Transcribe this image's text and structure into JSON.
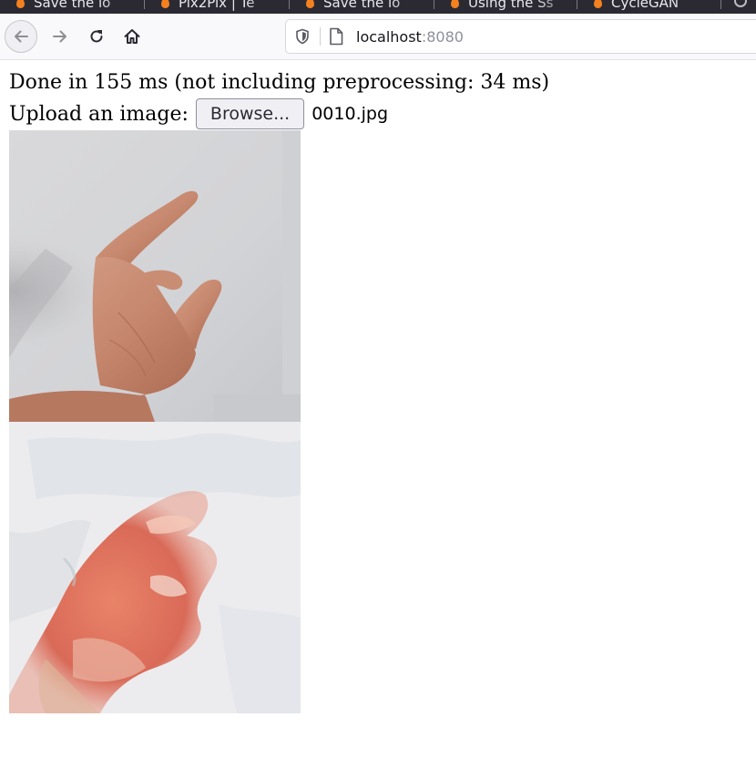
{
  "browser": {
    "tabs": [
      {
        "title": "Save the lo"
      },
      {
        "title": "Pix2Pix | Te"
      },
      {
        "title": "Save the lo"
      },
      {
        "title": "Using the Ss"
      },
      {
        "title": "CycleGAN"
      }
    ],
    "url": {
      "host": "localhost",
      "port": ":8080"
    },
    "icons": {
      "back": "back-arrow-icon",
      "forward": "forward-arrow-icon",
      "reload": "reload-icon",
      "home": "home-icon",
      "shield": "shield-icon",
      "page": "page-icon"
    }
  },
  "page": {
    "status": "Done in 155 ms (not including preprocessing: 34 ms)",
    "upload_label": "Upload an image:",
    "browse_label": "Browse...",
    "file_name": "0010.jpg"
  },
  "images": {
    "input": "photo of a hand against a light gray wall",
    "output": "stylized reddish hand generated from the input"
  },
  "colors": {
    "tabstrip_bg": "#2b2a33",
    "navbar_bg": "#f9f9fb",
    "favicon": "#f48120"
  }
}
